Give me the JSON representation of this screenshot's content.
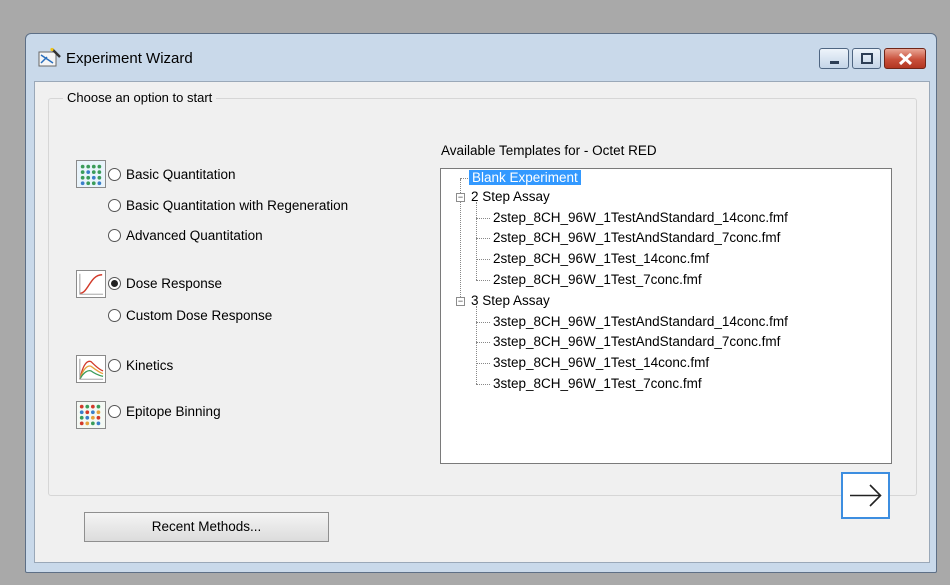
{
  "window": {
    "title": "Experiment Wizard"
  },
  "options_group": {
    "legend": "Choose an option to start",
    "options": [
      {
        "label": "Basic Quantitation",
        "checked": false
      },
      {
        "label": "Basic Quantitation with Regeneration",
        "checked": false
      },
      {
        "label": "Advanced Quantitation",
        "checked": false
      },
      {
        "label": "Dose Response",
        "checked": true
      },
      {
        "label": "Custom Dose Response",
        "checked": false
      },
      {
        "label": "Kinetics",
        "checked": false
      },
      {
        "label": "Epitope Binning",
        "checked": false
      }
    ],
    "icons": [
      "quantitation-icon",
      "dose-response-icon",
      "kinetics-icon",
      "epitope-binning-icon"
    ]
  },
  "templates": {
    "label": "Available Templates for - Octet RED",
    "root": "Blank Experiment",
    "groups": [
      {
        "label": "2 Step Assay",
        "expander": "−",
        "items": [
          "2step_8CH_96W_1TestAndStandard_14conc.fmf",
          "2step_8CH_96W_1TestAndStandard_7conc.fmf",
          "2step_8CH_96W_1Test_14conc.fmf",
          "2step_8CH_96W_1Test_7conc.fmf"
        ]
      },
      {
        "label": "3 Step Assay",
        "expander": "−",
        "items": [
          "3step_8CH_96W_1TestAndStandard_14conc.fmf",
          "3step_8CH_96W_1TestAndStandard_7conc.fmf",
          "3step_8CH_96W_1Test_14conc.fmf",
          "3step_8CH_96W_1Test_7conc.fmf"
        ]
      }
    ]
  },
  "buttons": {
    "next_icon": "arrow-right-icon",
    "recent": "Recent Methods..."
  },
  "colors": {
    "selection": "#3399ff",
    "next_border": "#3d8ee0"
  }
}
